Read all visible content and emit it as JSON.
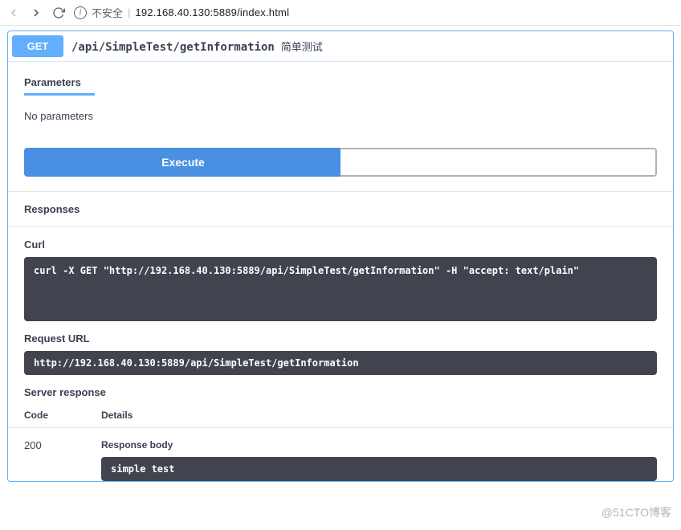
{
  "browser": {
    "insecure_label": "不安全",
    "url": "192.168.40.130:5889/index.html"
  },
  "operation": {
    "method": "GET",
    "path": "/api/SimpleTest/getInformation",
    "description": "简单测试"
  },
  "tabs": {
    "parameters": "Parameters"
  },
  "parameters": {
    "empty_text": "No parameters"
  },
  "buttons": {
    "execute": "Execute",
    "clear": ""
  },
  "sections": {
    "responses": "Responses",
    "curl": "Curl",
    "request_url": "Request URL",
    "server_response": "Server response",
    "response_body": "Response body"
  },
  "curl_command": "curl -X GET \"http://192.168.40.130:5889/api/SimpleTest/getInformation\" -H \"accept: text/plain\"",
  "request_url": "http://192.168.40.130:5889/api/SimpleTest/getInformation",
  "response_headers": {
    "code": "Code",
    "details": "Details"
  },
  "response": {
    "code": "200",
    "body": "simple test"
  },
  "watermark": "@51CTO博客"
}
